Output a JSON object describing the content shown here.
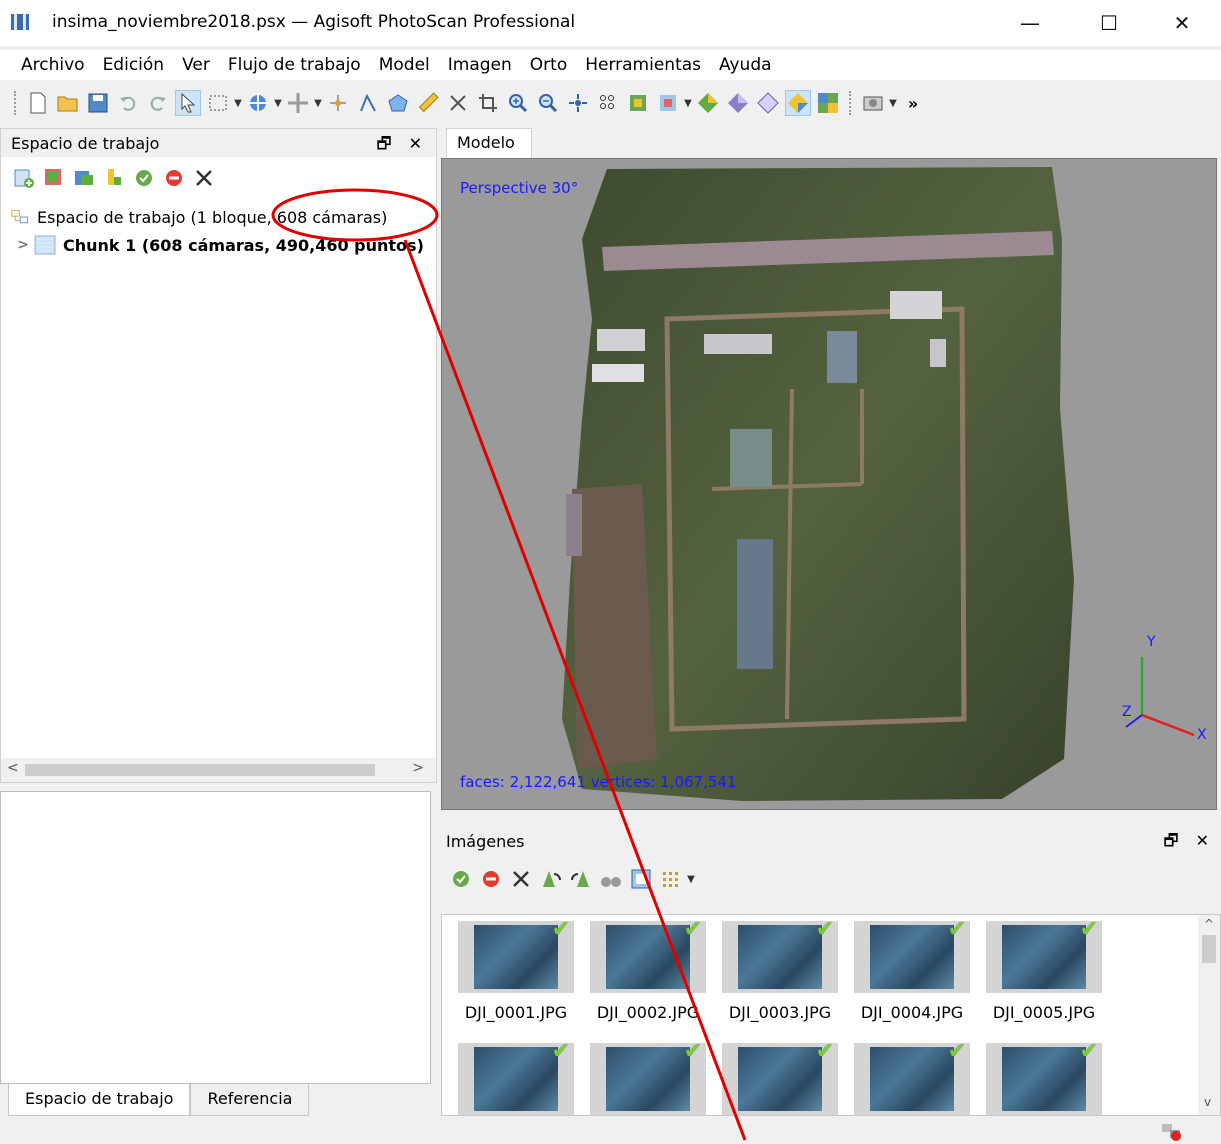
{
  "window": {
    "title": "insima_noviembre2018.psx — Agisoft PhotoScan Professional",
    "minimize": "—",
    "maximize": "☐",
    "close": "✕"
  },
  "menu": [
    "Archivo",
    "Edición",
    "Ver",
    "Flujo de trabajo",
    "Model",
    "Imagen",
    "Orto",
    "Herramientas",
    "Ayuda"
  ],
  "toolbar": {
    "overflow": "»"
  },
  "workspace": {
    "title": "Espacio de trabajo",
    "float_close": "🗗 ✕",
    "tree": [
      {
        "label": "Espacio de trabajo (1 bloque, 608 cámaras)"
      },
      {
        "label": "Chunk 1 (608 cámaras, 490,460 puntos)",
        "expander": ">"
      }
    ],
    "scroll_left": "<",
    "scroll_right": ">"
  },
  "bottom_tabs": [
    "Espacio de trabajo",
    "Referencia"
  ],
  "model": {
    "tab": "Modelo",
    "projection": "Perspective 30°",
    "stats": "faces: 2,122,641  vertices: 1,067,541",
    "axis_x": "X",
    "axis_y": "Y",
    "axis_z": "Z"
  },
  "images": {
    "title": "Imágenes",
    "float_close": "🗗 ✕",
    "items": [
      "DJI_0001.JPG",
      "DJI_0002.JPG",
      "DJI_0003.JPG",
      "DJI_0004.JPG",
      "DJI_0005.JPG"
    ],
    "scroll_up": "^",
    "scroll_down": "v"
  },
  "colors": {
    "annotation": "#e00000",
    "viewport_bg": "#9a9a9a",
    "label_blue": "#1a1aff",
    "check_green": "#7fc93f"
  }
}
